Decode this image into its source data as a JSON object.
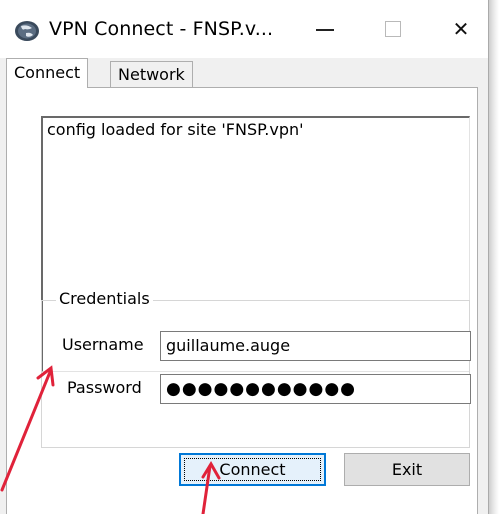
{
  "window": {
    "title": "VPN Connect - FNSP.v...",
    "app_icon": "globe-icon",
    "controls": {
      "minimize_icon": "minimize-icon",
      "maximize_icon": "maximize-icon",
      "close_glyph": "✕",
      "close_icon": "close-icon"
    }
  },
  "tabs": [
    {
      "label": "Connect",
      "active": true
    },
    {
      "label": "Network",
      "active": false
    }
  ],
  "log": {
    "text": "config loaded for site 'FNSP.vpn'"
  },
  "credentials": {
    "legend": "Credentials",
    "username_label": "Username",
    "username_value": "guillaume.auge",
    "password_label": "Password",
    "password_mask": "●●●●●●●●●●●●"
  },
  "buttons": {
    "connect": "Connect",
    "exit": "Exit"
  },
  "annotation_color": "#e0223a"
}
